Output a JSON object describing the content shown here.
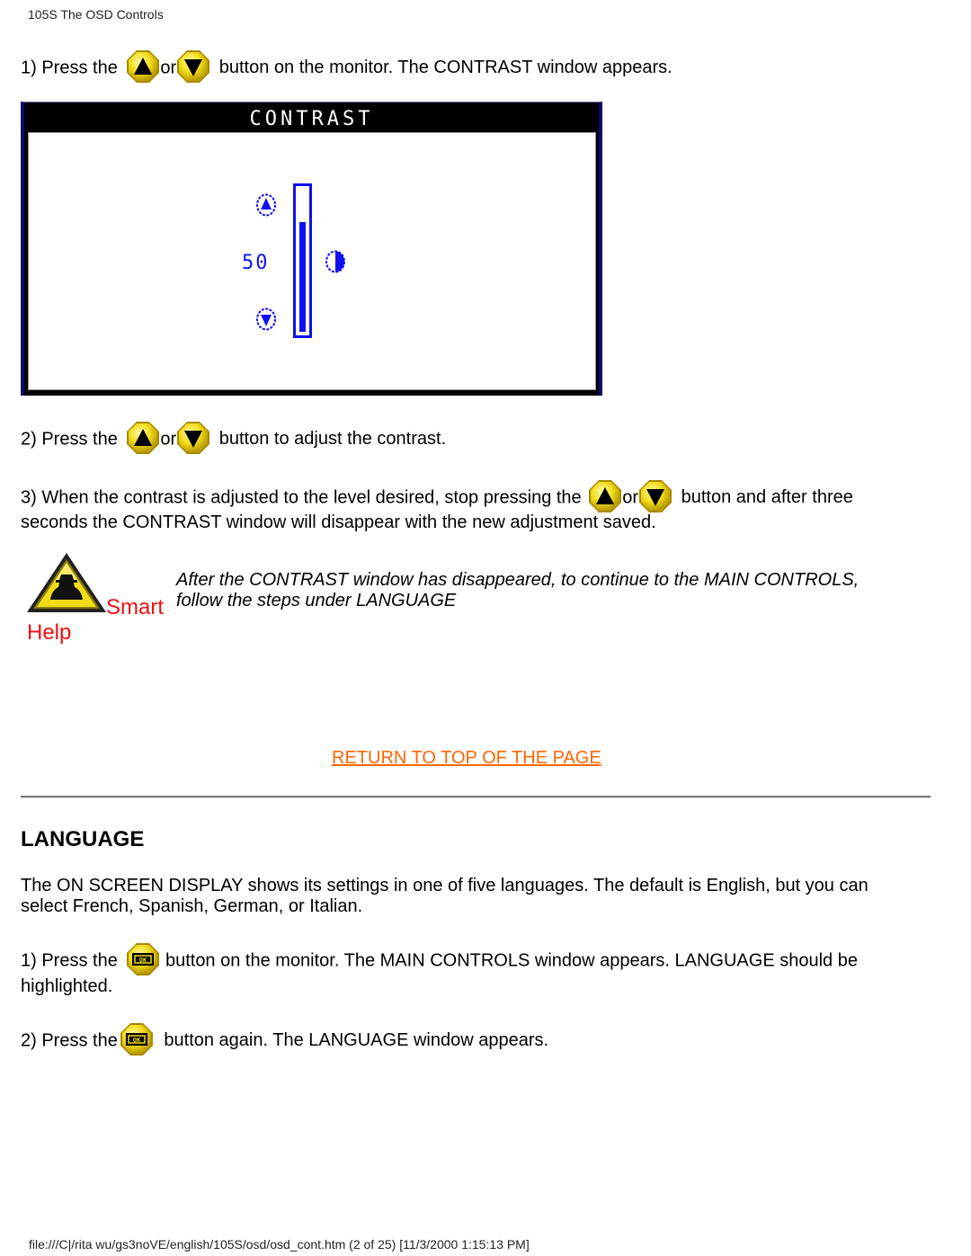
{
  "header": {
    "title": "105S The OSD Controls"
  },
  "icons": {
    "up_button": "up-arrow-button-icon",
    "down_button": "down-arrow-button-icon",
    "osd_button": "osd-button-icon",
    "smart_help": "smart-help-warning-icon",
    "contrast_glyph": "half-circle-contrast-icon"
  },
  "colors": {
    "button_yellow": "#f2dc1a",
    "osd_blue": "#1010ee",
    "smart_help_red": "#ee1111",
    "link_orange": "#ff6600"
  },
  "contrast_section": {
    "step1": {
      "prefix": "1) Press the",
      "or": "or",
      "suffix": "button on the monitor. The CONTRAST window appears."
    },
    "osd_window": {
      "title": "CONTRAST",
      "value_label": "50",
      "level_percent": 50
    },
    "step2": {
      "prefix": "2) Press the",
      "or": "or",
      "suffix": "button to adjust the contrast."
    },
    "step3": {
      "prefix": "3) When the contrast is adjusted to the level desired, stop pressing the",
      "or": "or",
      "suffix": "button and after three",
      "line2": "seconds the CONTRAST window will disappear with the new adjustment saved."
    },
    "smart_help": {
      "label_smart": "Smart",
      "label_help": "Help",
      "note_line1": "After the CONTRAST window has disappeared, to continue to the MAIN CONTROLS,",
      "note_line2": "follow the steps under LANGUAGE"
    },
    "return_link": "RETURN TO TOP OF THE PAGE"
  },
  "language_section": {
    "title": "LANGUAGE",
    "intro_line1": "The ON SCREEN DISPLAY shows its settings in one of five languages. The default is English, but you can",
    "intro_line2": "select French, Spanish, German, or Italian.",
    "step1": {
      "prefix": "1) Press the",
      "suffix": "button on the monitor. The MAIN CONTROLS window appears. LANGUAGE should be",
      "line2": "highlighted."
    },
    "step2": {
      "prefix": "2) Press the",
      "suffix": "button again. The LANGUAGE window appears."
    }
  },
  "footer": {
    "text": "file:///C|/rita wu/gs3noVE/english/105S/osd/osd_cont.htm (2 of 25) [11/3/2000 1:15:13 PM]"
  }
}
